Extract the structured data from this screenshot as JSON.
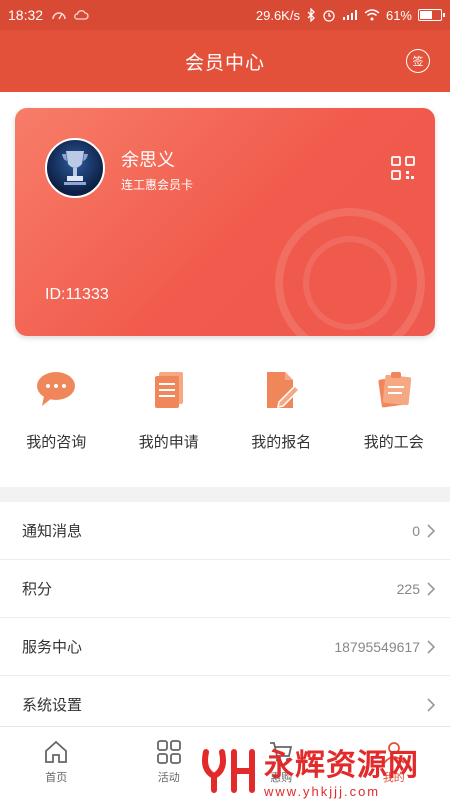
{
  "status": {
    "time": "18:32",
    "speed": "29.6K/s",
    "battery_text": "61%",
    "battery_level": 0.61
  },
  "header": {
    "title": "会员中心",
    "sign_label": "签"
  },
  "card": {
    "name": "余思义",
    "type": "连工惠会员卡",
    "id": "ID:11333"
  },
  "quick_actions": [
    {
      "label": "我的咨询",
      "icon": "chat-bubble-icon"
    },
    {
      "label": "我的申请",
      "icon": "document-icon"
    },
    {
      "label": "我的报名",
      "icon": "edit-document-icon"
    },
    {
      "label": "我的工会",
      "icon": "clipboard-icon"
    }
  ],
  "list": [
    {
      "label": "通知消息",
      "value": "0"
    },
    {
      "label": "积分",
      "value": "225"
    },
    {
      "label": "服务中心",
      "value": "18795549617"
    },
    {
      "label": "系统设置",
      "value": ""
    }
  ],
  "nav": [
    {
      "label": "首页",
      "icon": "home-icon"
    },
    {
      "label": "活动",
      "icon": "grid-icon"
    },
    {
      "label": "惠购",
      "icon": "cart-icon"
    },
    {
      "label": "我的",
      "icon": "person-icon"
    }
  ],
  "watermark": {
    "brand": "永辉资源网",
    "url": "www.yhkjjj.com"
  },
  "colors": {
    "primary": "#e4513b",
    "card": "#f15a4c"
  }
}
